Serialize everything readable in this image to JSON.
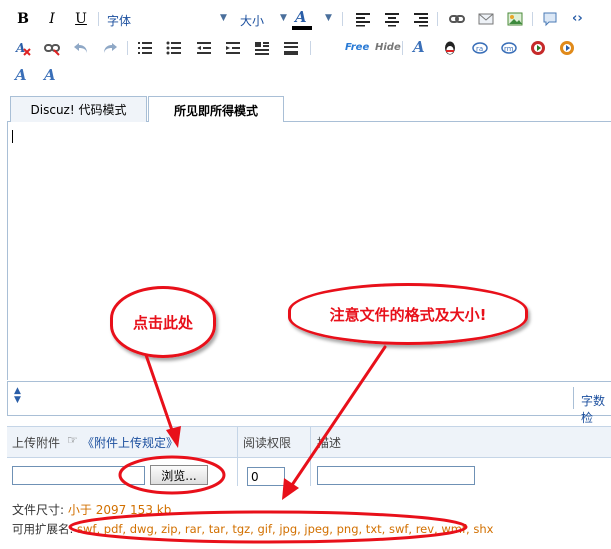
{
  "toolbar": {
    "bold": "B",
    "italic": "I",
    "underline": "U",
    "font_label": "字体",
    "size_label": "大小",
    "font_color_glyph": "A",
    "free_label": "Free",
    "hide_label": "Hide",
    "icons": [
      "bold-icon",
      "italic-icon",
      "underline-icon",
      "font-color-icon",
      "align-left-icon",
      "align-center-icon",
      "align-right-icon",
      "link-icon",
      "email-icon",
      "image-icon",
      "quote-icon",
      "code-icon",
      "remove-format-icon",
      "unlink-icon",
      "undo-icon",
      "redo-icon",
      "ordered-list-icon",
      "unordered-list-icon",
      "outdent-icon",
      "indent-icon",
      "table-icon",
      "hr-icon",
      "free-icon",
      "hide-icon",
      "font-style-icon",
      "qq-icon",
      "ra-icon",
      "rm-icon",
      "flash-icon",
      "media-icon",
      "font-a-icon",
      "font-a2-icon"
    ]
  },
  "tabs": {
    "code_mode": "Discuz! 代码模式",
    "wysiwyg_mode": "所见即所得模式"
  },
  "editor": {
    "word_count_label": "字数检"
  },
  "attachment": {
    "upload_label": "上传附件",
    "rules_link": "《附件上传规定》",
    "read_perm_label": "阅读权限",
    "desc_label": "描述",
    "browse_button": "浏览...",
    "read_perm_value": "0",
    "filesize_label": "文件尺寸:",
    "filesize_value": "小于 2097 153 kb",
    "ext_label": "可用扩展名:",
    "ext_value": "swf, pdf, dwg, zip, rar, tar, tgz, gif, jpg, jpeg, png, txt, swf, rev, wmf, shx"
  },
  "annotations": {
    "click_here": "点击此处",
    "note_format": "注意文件的格式及大小!"
  },
  "colors": {
    "accent_red": "#e8101a",
    "orange_text": "#d27000",
    "link_blue": "#1b4f9e",
    "border_blue": "#a9bfd6"
  }
}
